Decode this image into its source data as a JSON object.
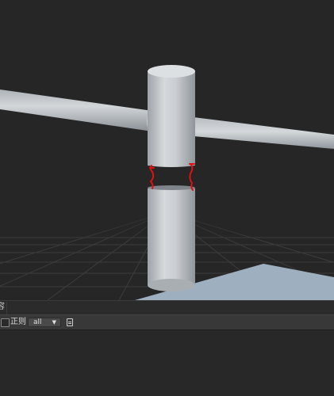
{
  "bottom_panel": {
    "tab_label": "容",
    "filter": {
      "checkbox_label": "正则",
      "dropdown_value": "all",
      "dropdown_arrow": "▼"
    }
  },
  "icons": [
    "doc-icon",
    "chevron-down-icon"
  ],
  "colors": {
    "viewport_bg": "#262626",
    "cylinder": "#c8ccd1",
    "ground_plane": "#9eafc0",
    "gap_marker": "#e01010",
    "panel_bg": "#383838"
  }
}
